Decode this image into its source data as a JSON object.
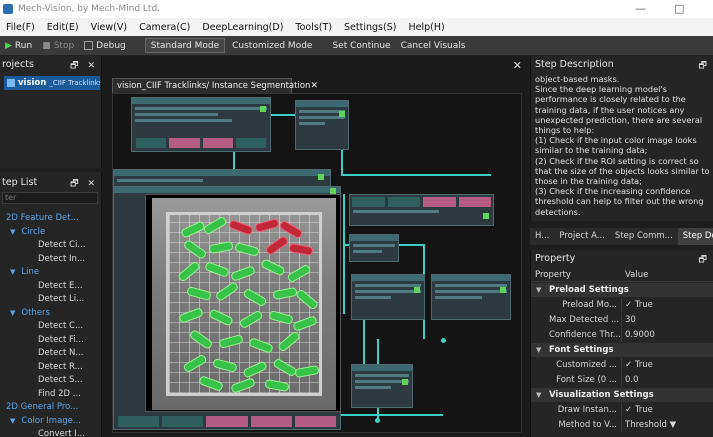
{
  "titlebar": {
    "title": "Mech-Vision, by Mech-Mind Ltd.",
    "minimize": "—",
    "maximize": "□"
  },
  "menu": [
    "File(F)",
    "Edit(E)",
    "View(V)",
    "Camera(C)",
    "DeepLearning(D)",
    "Tools(T)",
    "Settings(S)",
    "Help(H)"
  ],
  "toolbar": {
    "run": "Run",
    "stop": "Stop",
    "debug": "Debug",
    "standard_mode": "Standard Mode",
    "customized_mode": "Customized Mode",
    "set_continue": "Set Continue",
    "cancel_visuals": "Cancel Visuals"
  },
  "projects": {
    "title": "rojects",
    "controls": "🗗 ✕",
    "item_name": "vision",
    "item_sub": "_CIIF Tracklinks"
  },
  "steplist": {
    "title": "tep List",
    "controls": "🗗 ✕",
    "search_placeholder": "ter",
    "rows": [
      {
        "text": "2D Feature Det...",
        "type": "cat",
        "level": 0
      },
      {
        "text": "Circle",
        "type": "cat",
        "level": 1,
        "tri": true
      },
      {
        "text": "Detect Ci...",
        "type": "item",
        "level": 2
      },
      {
        "text": "Detect In...",
        "type": "item",
        "level": 2
      },
      {
        "text": "Line",
        "type": "cat",
        "level": 1,
        "tri": true
      },
      {
        "text": "Detect E...",
        "type": "item",
        "level": 2
      },
      {
        "text": "Detect Li...",
        "type": "item",
        "level": 2
      },
      {
        "text": "Others",
        "type": "cat",
        "level": 1,
        "tri": true
      },
      {
        "text": "Detect C...",
        "type": "item",
        "level": 2
      },
      {
        "text": "Detect Fi...",
        "type": "item",
        "level": 2
      },
      {
        "text": "Detect N...",
        "type": "item",
        "level": 2
      },
      {
        "text": "Detect R...",
        "type": "item",
        "level": 2
      },
      {
        "text": "Detect S...",
        "type": "item",
        "level": 2
      },
      {
        "text": "Find 2D ...",
        "type": "item",
        "level": 2
      },
      {
        "text": "2D General Pro...",
        "type": "cat",
        "level": 0
      },
      {
        "text": "Color Image...",
        "type": "cat",
        "level": 1,
        "tri": true
      },
      {
        "text": "Convert I...",
        "type": "item",
        "level": 2
      }
    ]
  },
  "editor": {
    "close": "✕",
    "tab_label": "vision_CIIF Tracklinks/ Instance Segmentation",
    "tab_close": "✕"
  },
  "stepdesc": {
    "title": "Step Description",
    "pin": "🗗",
    "paragraphs": [
      "object-based masks.",
      "Since the deep learning model's performance is closely related to the training data, if the user notices any unexpected prediction, there are several things to help:",
      "(1) Check if the input color image looks similar to the training data;",
      "(2) Check if the ROI setting is correct so that the size of the objects looks similar to those in the training data;",
      "(3) Check if the increasing confidence threshold can help to filter out the wrong detections."
    ]
  },
  "rtabs": [
    "H...",
    "Project A...",
    "Step Comm...",
    "Step Des"
  ],
  "property": {
    "title": "Property",
    "pin": "🗗",
    "col_property": "Property",
    "col_value": "Value",
    "rows": [
      {
        "kind": "group",
        "key": "Preload Settings"
      },
      {
        "kind": "item",
        "key": "Preload Mo...",
        "value": "✓  True"
      },
      {
        "kind": "item",
        "key": "Max Detected ...",
        "value": "30"
      },
      {
        "kind": "item",
        "key": "Confidence Thr...",
        "value": "0.9000"
      },
      {
        "kind": "group",
        "key": "Font Settings"
      },
      {
        "kind": "item",
        "key": "Customized ...",
        "value": "✓  True"
      },
      {
        "kind": "item",
        "key": "Font Size (0 ...",
        "value": "0.0"
      },
      {
        "kind": "group",
        "key": "Visualization Settings"
      },
      {
        "kind": "item",
        "key": "Draw Instan...",
        "value": "✓  True"
      },
      {
        "kind": "item",
        "key": "Method to V...",
        "value": "Threshold ▼"
      }
    ]
  },
  "colors": {
    "accent": "#1a5a9a",
    "category": "#5aa6e8",
    "wire": "#3ccfc3",
    "mask_ok": "#39c24a",
    "mask_bad": "#c0283a"
  }
}
